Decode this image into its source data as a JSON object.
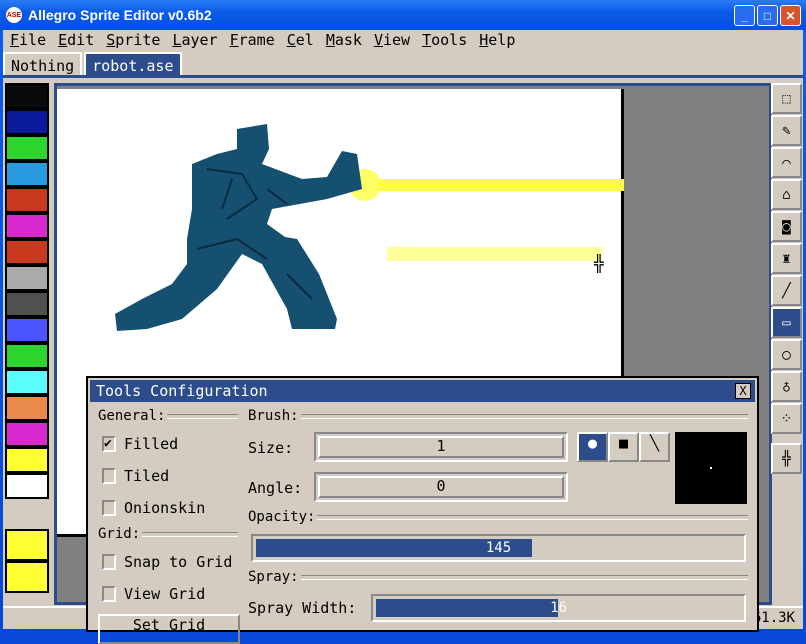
{
  "window": {
    "title": "Allegro Sprite Editor v0.6b2",
    "icon_text": "ASE"
  },
  "menu": [
    "File",
    "Edit",
    "Sprite",
    "Layer",
    "Frame",
    "Cel",
    "Mask",
    "View",
    "Tools",
    "Help"
  ],
  "tabs": [
    {
      "label": "Nothing",
      "active": false
    },
    {
      "label": "robot.ase",
      "active": true
    }
  ],
  "palette": [
    "#0a0a0a",
    "#0c1a9c",
    "#2ed42e",
    "#2a9be0",
    "#c83a20",
    "#d82ad0",
    "#c83a20",
    "#aaaaaa",
    "#505050",
    "#4a55ff",
    "#2ed42e",
    "#5afcfc",
    "#e88a4a",
    "#d82ad0",
    "#ffff33",
    "#ffffff"
  ],
  "fg_color": "#ffff33",
  "bg_color": "#ffff33",
  "tools": [
    "rectangle-select",
    "pencil",
    "brush",
    "eraser",
    "floodfill",
    "spray",
    "line",
    "rectangle",
    "ellipse",
    "blur",
    "jumble",
    "move"
  ],
  "selected_tool": "rectangle",
  "status": {
    "size": "61.3K"
  },
  "dialog": {
    "title": "Tools Configuration",
    "close": "X",
    "general_label": "General:",
    "filled": "Filled",
    "tiled": "Tiled",
    "onionskin": "Onionskin",
    "grid_label": "Grid:",
    "snap": "Snap to Grid",
    "view_grid": "View Grid",
    "set_grid": "Set Grid",
    "brush_label": "Brush:",
    "size_label": "Size:",
    "size": "1",
    "angle_label": "Angle:",
    "angle": "0",
    "brush_types": [
      "circle",
      "square",
      "line"
    ],
    "opacity_label": "Opacity:",
    "opacity": "145",
    "opacity_max": 255,
    "spray_label": "Spray:",
    "spray_width_label": "Spray Width:",
    "spray_width": "16",
    "spray_width_max": 32,
    "checks": {
      "filled": true,
      "tiled": false,
      "onionskin": false,
      "snap": false,
      "view_grid": false
    }
  }
}
